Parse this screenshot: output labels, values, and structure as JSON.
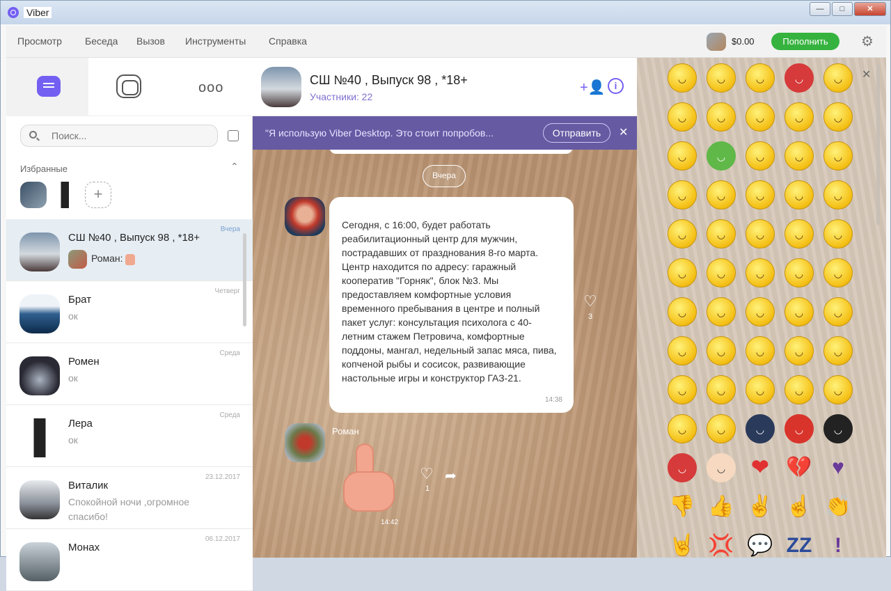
{
  "window": {
    "title": "Viber",
    "buttons": [
      "—",
      "□",
      "✕"
    ]
  },
  "menu": {
    "items": [
      "Просмотр",
      "Беседа",
      "Вызов",
      "Инструменты",
      "Справка"
    ],
    "balance": "$0.00",
    "topup_label": "Пополнить"
  },
  "sidebar": {
    "tabs": [
      "chats",
      "stories",
      "more"
    ],
    "more_label": "ooo",
    "search_placeholder": "Поиск...",
    "favorites_label": "Избранные",
    "chats": [
      {
        "name": "СШ №40 , Выпуск  98 , *18+",
        "preview_sender": "Роман:",
        "preview": "",
        "time": "Вчера",
        "active": true,
        "avatar_color": "#5f6f80"
      },
      {
        "name": "Брат",
        "preview": "ок",
        "time": "Четверг",
        "avatar_color": "#2f5f8f"
      },
      {
        "name": "Ромен",
        "preview": "ок",
        "time": "Среда",
        "avatar_color": "#2a2a35"
      },
      {
        "name": "Лера",
        "preview": "ок",
        "time": "Среда",
        "avatar_color": "#d8d8d8"
      },
      {
        "name": "Виталик",
        "preview": "Спокойной ночи ,огромное спасибо!",
        "time": "23.12.2017",
        "avatar_color": "#8a9099"
      },
      {
        "name": "Монах",
        "preview": "",
        "time": "06.12.2017",
        "avatar_color": "#556066"
      }
    ]
  },
  "chat": {
    "title": "СШ №40 , Выпуск  98 , *18+",
    "members": "Участники: 22",
    "banner_text": "\"Я использую Viber Desktop. Это стоит попробов...",
    "banner_send": "Отправить",
    "date_separator": "Вчера",
    "message_text": "Сегодня, с 16:00, будет работать реабилитационный центр для мужчин, пострадавших от празднования 8-го марта. Центр находится по адресу: гаражный кооператив \"Горняк\", блок №3. Мы предоставляем комфортные условия временного пребывания в центре и полный пакет услуг: консультация психолога с 40-летним стажем Петровича, комфортные поддоны, мангал, недельный запас мяса, пива, копченой рыбы и сосисок, развивающие настольные игры и конструктор ГАЗ-21.",
    "message_time": "14:38",
    "message_likes": "3",
    "sticker_sender": "Роман",
    "sticker_time": "14:42",
    "sticker_likes": "1"
  },
  "emoji_panel": {
    "rows": [
      [
        "smile",
        "neutral",
        "wink-tongue",
        "angry-red",
        "heart-eyes"
      ],
      [
        "tongue",
        "laugh",
        "shock",
        "kiss-heart",
        "grin"
      ],
      [
        "cry-loud",
        "sick-green",
        "worried",
        "grin-teeth",
        "tongue-side"
      ],
      [
        "money-eyes",
        "smirk",
        "wink",
        "laugh-tear",
        "meh"
      ],
      [
        "sad",
        "crazy",
        "nerd",
        "unamused",
        "cool"
      ],
      [
        "whistle",
        "rofl",
        "kiss",
        "tongue-out",
        "big-grin"
      ],
      [
        "dizzy",
        "dead",
        "hmm",
        "eye-roll",
        "annoyed"
      ],
      [
        "grimace",
        "surprised",
        "smug",
        "tired",
        "pensive"
      ],
      [
        "mad",
        "frustrated",
        "teary",
        "music",
        "drool"
      ],
      [
        "confused",
        "angry",
        "ninja",
        "spider",
        "bat"
      ],
      [
        "devil",
        "angel",
        "heart",
        "broken-heart",
        "purple-heart"
      ],
      [
        "thumbs-down",
        "thumbs-up",
        "peace",
        "finger",
        "clap"
      ],
      [
        "rock",
        "anger",
        "speech",
        "zzz",
        "exclaim"
      ]
    ]
  }
}
